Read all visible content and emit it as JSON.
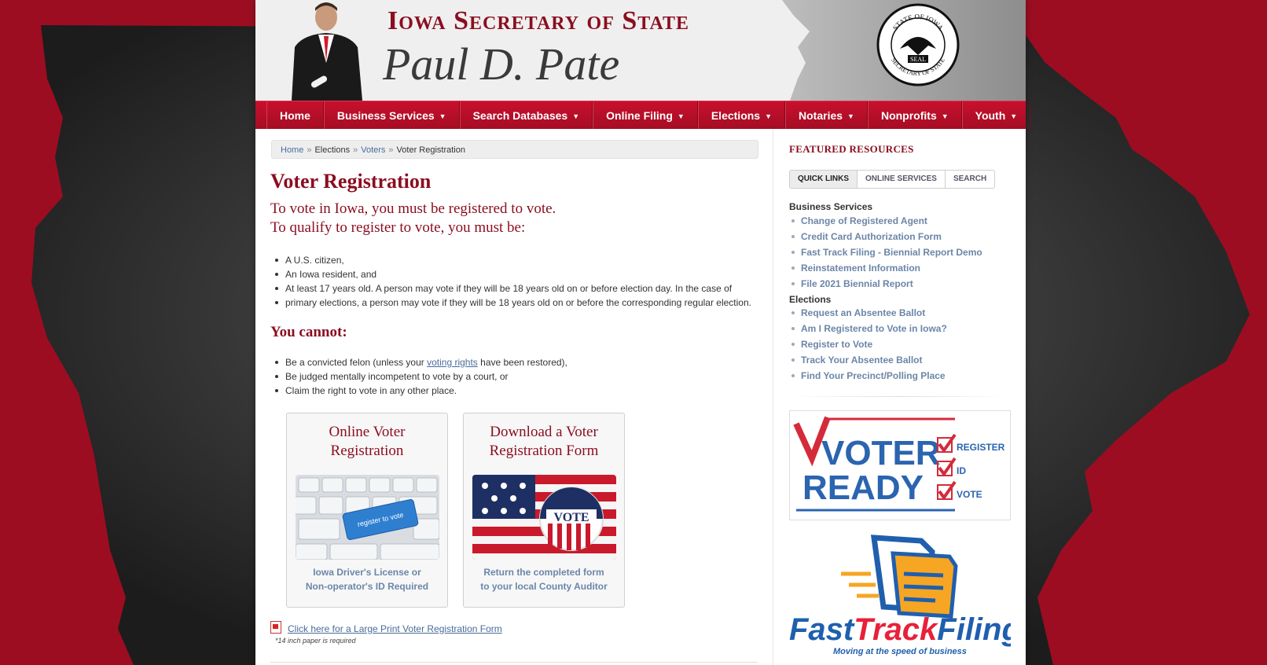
{
  "header": {
    "site_title": "Iowa Secretary of State",
    "official_name": "Paul D. Pate",
    "seal_text_top": "STATE OF IOWA",
    "seal_text_bottom": "SECRETARY OF STATE",
    "seal_center": "SEAL"
  },
  "nav": {
    "items": [
      {
        "label": "Home"
      },
      {
        "label": "Business Services"
      },
      {
        "label": "Search Databases"
      },
      {
        "label": "Online Filing"
      },
      {
        "label": "Elections"
      },
      {
        "label": "Notaries"
      },
      {
        "label": "Nonprofits"
      },
      {
        "label": "Youth"
      }
    ],
    "caret": "▼"
  },
  "breadcrumb": {
    "home": "Home",
    "elections": "Elections",
    "voters": "Voters",
    "current": "Voter Registration",
    "sep": "»"
  },
  "main": {
    "title": "Voter Registration",
    "intro_line1": "To vote in Iowa, you must be registered to vote.",
    "intro_line2": "To qualify to register to vote, you must be:",
    "requirements": [
      "A U.S. citizen,",
      "An Iowa resident, and",
      "At least 17 years old. A person may vote if they will be 18 years old on or before election day. In the case of",
      "primary elections, a person may vote if they will be 18 years old on or before the corresponding regular election."
    ],
    "cannot_title": "You cannot:",
    "cannot_1_pre": "Be a convicted felon (unless your ",
    "cannot_1_link": "voting rights",
    "cannot_1_post": " have been restored),",
    "cannot_2": "Be judged mentally incompetent to vote by a court, or",
    "cannot_3": "Claim the right to vote in any other place.",
    "card_online": {
      "title_1": "Online Voter",
      "title_2": "Registration",
      "key_label": "register to vote",
      "caption_1": "Iowa Driver's License or",
      "caption_2": "Non-operator's ID Required"
    },
    "card_download": {
      "title_1": "Download a Voter",
      "title_2": "Registration Form",
      "badge": "VOTE",
      "caption_1": "Return the completed form",
      "caption_2": "to your local County Auditor"
    },
    "large_print_link": "Click here for a Large Print Voter Registration Form",
    "paper_note": "*14 inch paper is required"
  },
  "sidebar": {
    "title": "FEATURED RESOURCES",
    "tabs": [
      "QUICK LINKS",
      "ONLINE SERVICES",
      "SEARCH"
    ],
    "business_heading": "Business Services",
    "business_links": [
      "Change of Registered Agent",
      "Credit Card Authorization Form",
      "Fast Track Filing - Biennial Report Demo",
      "Reinstatement Information",
      "File 2021 Biennial Report"
    ],
    "elections_heading": "Elections",
    "elections_links": [
      "Request an Absentee Ballot",
      "Am I Registered to Vote in Iowa?",
      "Register to Vote",
      "Track Your Absentee Ballot",
      "Find Your Precinct/Polling Place"
    ],
    "voter_ready": {
      "line1": "VOTER",
      "line2": "READY",
      "item1": "REGISTER",
      "item2": "ID",
      "item3": "VOTE"
    },
    "fasttrack": {
      "word1": "Fast",
      "word2": "Track",
      "word3": "Filing",
      "tagline": "Moving at the speed of business"
    }
  },
  "colors": {
    "brand_red": "#8b0d1f",
    "nav_red": "#c8102e",
    "link_blue": "#6b86a8"
  }
}
